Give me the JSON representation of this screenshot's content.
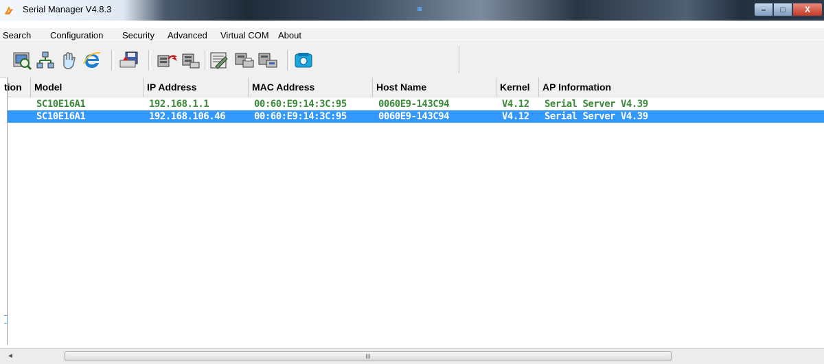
{
  "window": {
    "title": "Serial Manager V4.8.3",
    "minimize_glyph": "–",
    "maximize_glyph": "□",
    "close_glyph": "X"
  },
  "menu": [
    "Search",
    "Configuration",
    "Security",
    "Advanced",
    "Virtual COM",
    "About"
  ],
  "toolbar_icons": [
    "search-device-icon",
    "network-config-icon",
    "security-hand-icon",
    "internet-explorer-icon",
    "save-icon",
    "upload-icon",
    "download-icon",
    "settings-form-icon",
    "device-print-icon",
    "device-copy-icon",
    "telephone-icon"
  ],
  "table": {
    "columns": [
      "tion",
      "Model",
      "IP Address",
      "MAC Address",
      "Host Name",
      "Kernel",
      "AP Information"
    ],
    "rows": [
      {
        "location": "",
        "model": "SC10E16A1",
        "ip": "192.168.1.1",
        "mac": "00:60:E9:14:3C:95",
        "host": "0060E9-143C94",
        "kernel": "V4.12",
        "ap": "Serial Server V4.39",
        "selected": false
      },
      {
        "location": "",
        "model": "SC10E16A1",
        "ip": "192.168.106.46",
        "mac": "00:60:E9:14:3C:95",
        "host": "0060E9-143C94",
        "kernel": "V4.12",
        "ap": "Serial Server V4.39",
        "selected": true
      }
    ]
  },
  "scrollbar": {
    "left_glyph": "◄",
    "grip": "III"
  },
  "colors": {
    "row_text": "#3a8a3a",
    "selection": "#3399ff"
  }
}
